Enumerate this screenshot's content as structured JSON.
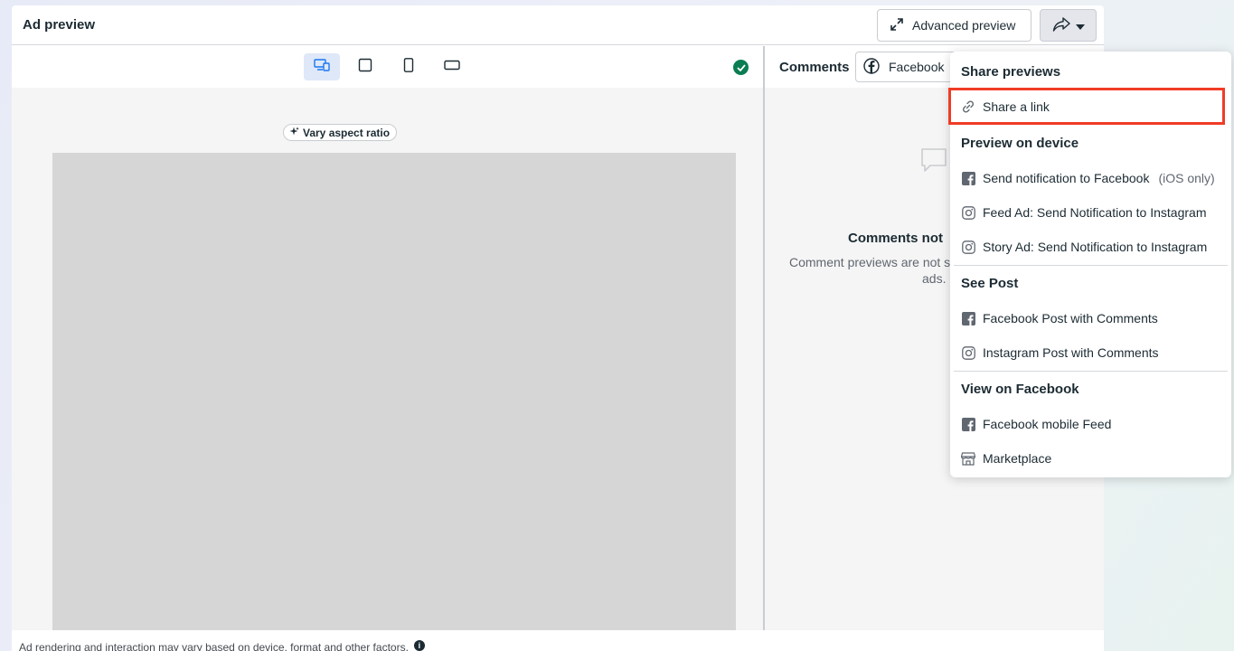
{
  "header": {
    "title": "Ad preview",
    "advanced_preview_label": "Advanced preview"
  },
  "preview": {
    "vary_aspect_ratio_label": "Vary aspect ratio",
    "footer_text": "Ad rendering and interaction may vary based on device, format and other factors."
  },
  "comments": {
    "label": "Comments",
    "platform_selected": "Facebook",
    "empty_title": "Comments not",
    "empty_text_line1": "Comment previews are not s",
    "empty_text_line2": "ads."
  },
  "menu": {
    "share_previews": "Share previews",
    "share_link": "Share a link",
    "preview_on_device": "Preview on device",
    "send_fb": "Send notification to Facebook",
    "send_fb_note": "(iOS only)",
    "feed_ig": "Feed Ad: Send Notification to Instagram",
    "story_ig": "Story Ad: Send Notification to Instagram",
    "see_post": "See Post",
    "fb_post_comments": "Facebook Post with Comments",
    "ig_post_comments": "Instagram Post with Comments",
    "view_on_facebook": "View on Facebook",
    "fb_mobile_feed": "Facebook mobile Feed",
    "marketplace": "Marketplace"
  },
  "colors": {
    "highlight": "#f03c25",
    "check": "#0a7d52",
    "active_device": "#dfe8f8"
  }
}
